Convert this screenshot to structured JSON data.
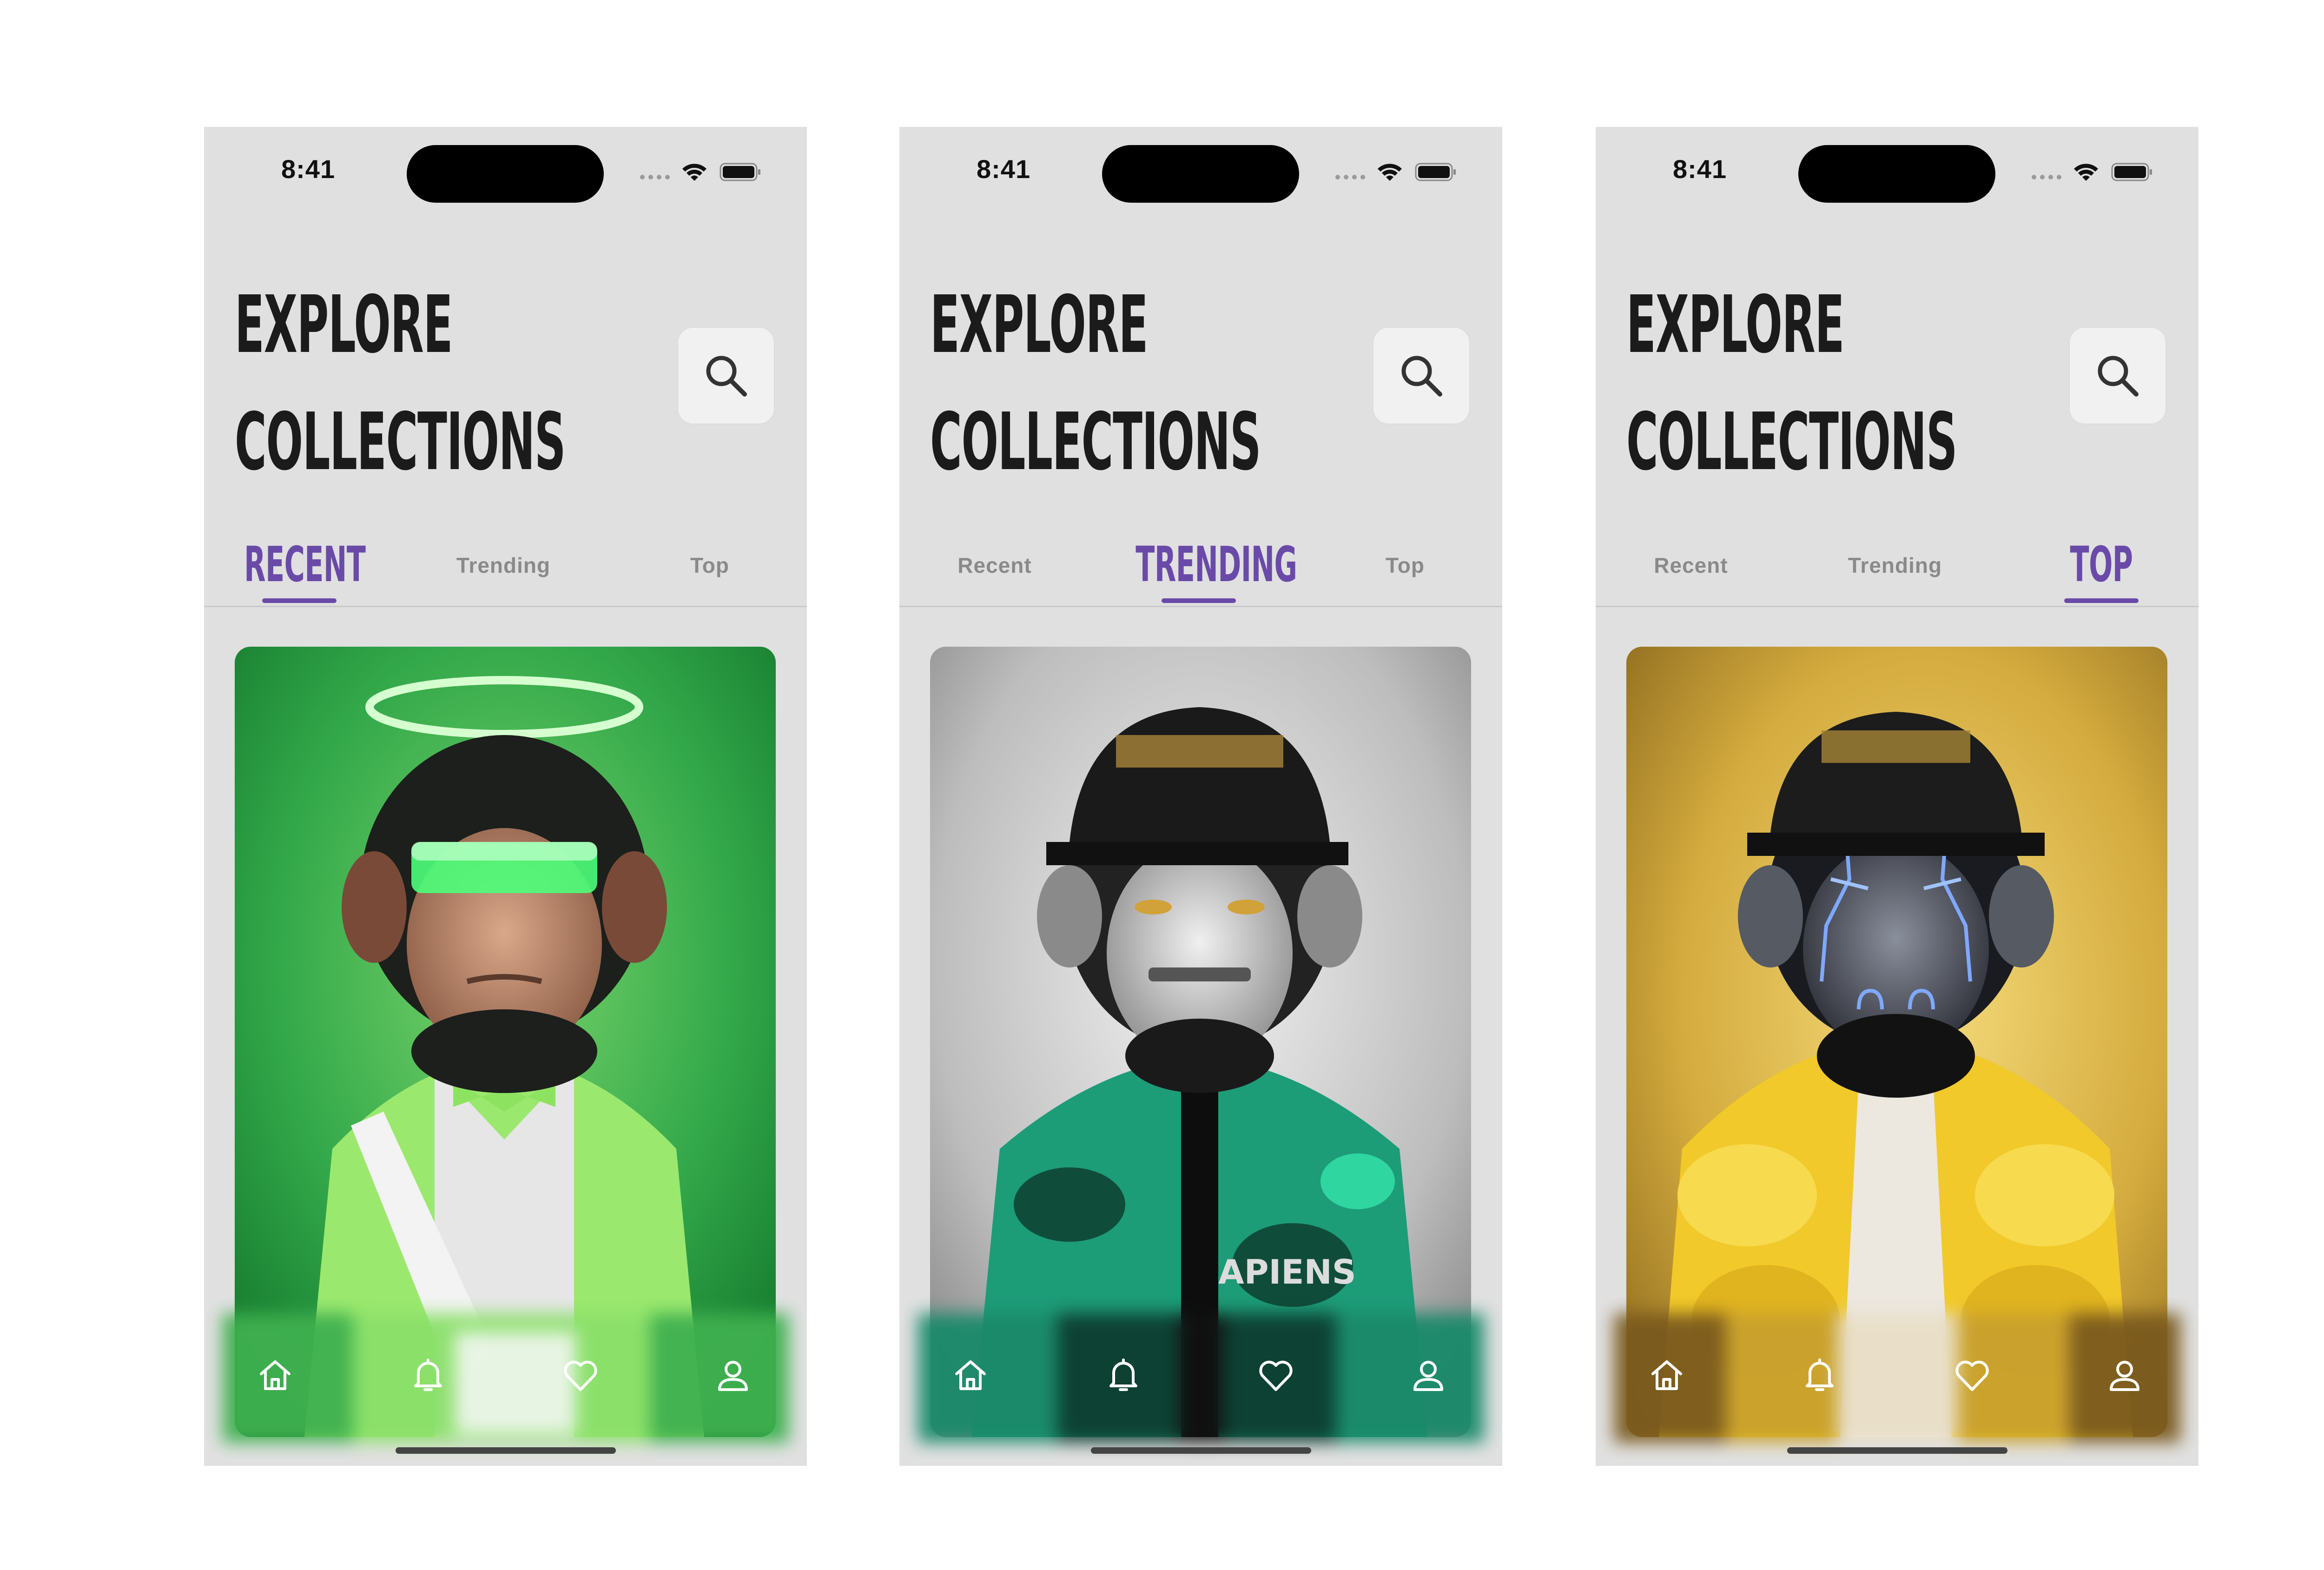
{
  "screens": [
    {
      "status": {
        "time": "8:41"
      },
      "title": {
        "line1": "EXPLORE",
        "line2": "COLLECTIONS"
      },
      "tabs": [
        "Recent",
        "Trending",
        "Top"
      ],
      "active_tab": "RECENT",
      "active_index": 0,
      "card": {
        "theme": "green",
        "background": "#2fa64a",
        "accent": "#7ee35a",
        "image": "ape-with-halo-green-suit"
      }
    },
    {
      "status": {
        "time": "8:41"
      },
      "title": {
        "line1": "EXPLORE",
        "line2": "COLLECTIONS"
      },
      "tabs": [
        "Recent",
        "Trending",
        "Top"
      ],
      "active_tab": "TRENDING",
      "active_index": 1,
      "card": {
        "theme": "grey",
        "background": "#b9b9b9",
        "accent": "#1fae82",
        "image": "ape-with-spiked-cap-camo-jacket"
      }
    },
    {
      "status": {
        "time": "8:41"
      },
      "title": {
        "line1": "EXPLORE",
        "line2": "COLLECTIONS"
      },
      "tabs": [
        "Recent",
        "Trending",
        "Top"
      ],
      "active_tab": "TOP",
      "active_index": 2,
      "card": {
        "theme": "yellow",
        "background": "#c9a12d",
        "accent": "#f2cf2c",
        "image": "ape-with-spiked-cap-yellow-puffer"
      }
    }
  ],
  "nav": {
    "icons": [
      "home-icon",
      "bell-icon",
      "heart-icon",
      "user-icon"
    ]
  },
  "colors": {
    "accent": "#6a4aa8",
    "screen_bg": "#e0e0e0",
    "text": "#1b1b1b"
  }
}
